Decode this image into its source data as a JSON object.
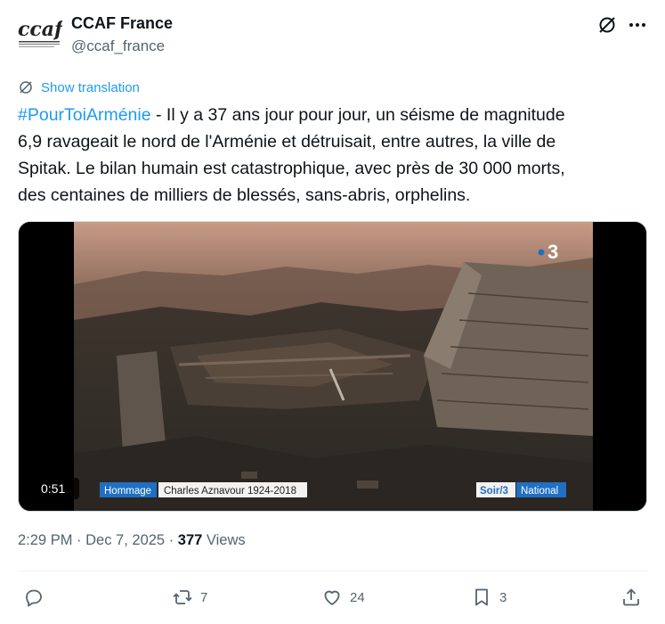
{
  "author": {
    "display_name": "CCAF France",
    "handle": "@ccaf_france",
    "logo_text": "ccaf"
  },
  "translate_label": "Show translation",
  "tweet": {
    "hashtag": "#PourToiArménie",
    "line1_rest": " - Il y a 37 ans jour pour jour, un séisme de magnitude",
    "line2": "6,9 ravageait le nord de l'Arménie et détruisait, entre autres, la ville de",
    "line3": "Spitak.  Le bilan humain est catastrophique, avec près de 30 000 morts,",
    "line4": "des centaines de milliers de blessés, sans-abris, orphelins."
  },
  "video": {
    "duration": "0:51",
    "channel_logo": "3",
    "lower_third_tag": "Hommage",
    "lower_third_title": "Charles Aznavour 1924-2018",
    "program_tag": "Soir/3",
    "program_name": "National"
  },
  "meta": {
    "time": "2:29 PM",
    "separator": " · ",
    "date": "Dec 7, 2025",
    "views_count": "377",
    "views_label": " Views"
  },
  "actions": {
    "reply_count": "",
    "retweet_count": "7",
    "like_count": "24",
    "bookmark_count": "3"
  },
  "colors": {
    "accent": "#1d9bf0",
    "secondary_text": "#536471",
    "primary_text": "#0f1419",
    "tv_blue": "#1f6fc2"
  }
}
